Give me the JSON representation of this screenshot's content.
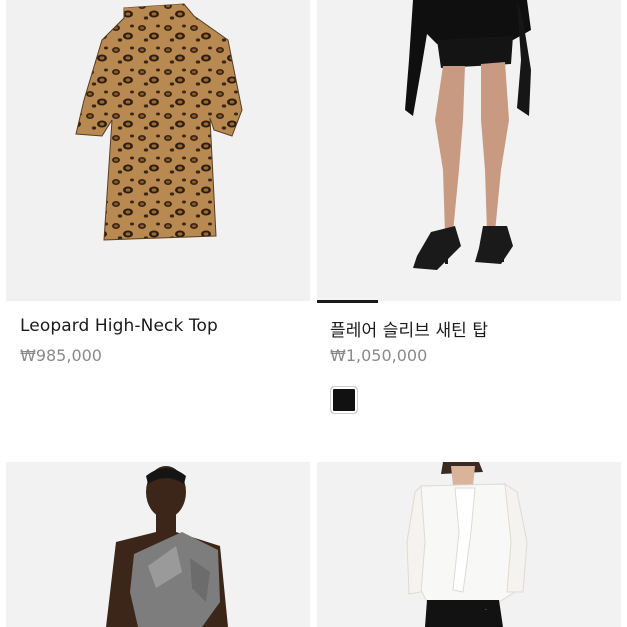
{
  "products": [
    {
      "title": "Leopard High-Neck Top",
      "price": "₩985,000",
      "image_icon": "leopard-top-photo"
    },
    {
      "title": "플레어 슬리브 새틴 탑",
      "price": "₩1,050,000",
      "image_icon": "black-satin-top-photo",
      "swatch_color": "#111111",
      "image_carousel_progress": 0.2
    },
    {
      "title": "",
      "price": "",
      "image_icon": "grey-draped-top-photo"
    },
    {
      "title": "",
      "price": "",
      "image_icon": "white-bow-blouse-photo"
    }
  ],
  "colors": {
    "image_bg": "#f1f1f1",
    "title_text": "#1a1a1a",
    "price_text": "#8a8a8a"
  }
}
